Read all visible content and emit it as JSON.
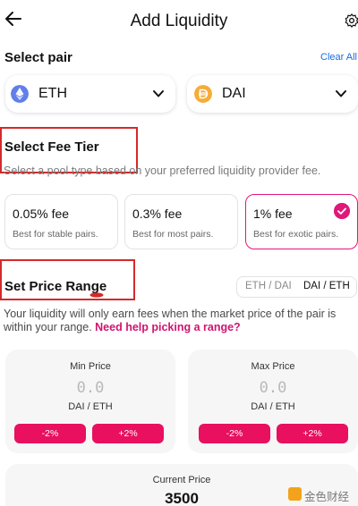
{
  "header": {
    "title": "Add Liquidity",
    "back_icon": "arrow-left-icon",
    "settings_icon": "gear-icon"
  },
  "pair": {
    "label": "Select pair",
    "clear_all": "Clear All",
    "token_a": {
      "symbol": "ETH",
      "icon": "eth-icon",
      "icon_color": "#627eea"
    },
    "token_b": {
      "symbol": "DAI",
      "icon": "dai-icon",
      "icon_color": "#f5ac37"
    }
  },
  "fee": {
    "label": "Select Fee Tier",
    "description": "Select a pool type based on your preferred liquidity provider fee.",
    "tiers": [
      {
        "value": "0.05% fee",
        "desc": "Best for stable pairs.",
        "selected": false
      },
      {
        "value": "0.3% fee",
        "desc": "Best for most pairs.",
        "selected": false
      },
      {
        "value": "1% fee",
        "desc": "Best for exotic pairs.",
        "selected": true
      }
    ]
  },
  "range": {
    "label": "Set Price Range",
    "toggle": {
      "option_a": "ETH / DAI",
      "option_b": "DAI / ETH",
      "active": "DAI / ETH"
    },
    "info_text": "Your liquidity will only earn fees when the market price of the pair is within your range.",
    "help_link": "Need help picking a range?",
    "min": {
      "label": "Min Price",
      "value": "0.0",
      "unit": "DAI / ETH",
      "dec_label": "-2%",
      "inc_label": "+2%"
    },
    "max": {
      "label": "Max Price",
      "value": "0.0",
      "unit": "DAI / ETH",
      "dec_label": "-2%",
      "inc_label": "+2%"
    },
    "current": {
      "label": "Current Price",
      "value": "3500"
    }
  },
  "colors": {
    "accent": "#e0187a",
    "button": "#e8105f",
    "link": "#1a6de0",
    "annotation": "#d42a2a"
  },
  "watermark": {
    "text": "金色财经"
  }
}
